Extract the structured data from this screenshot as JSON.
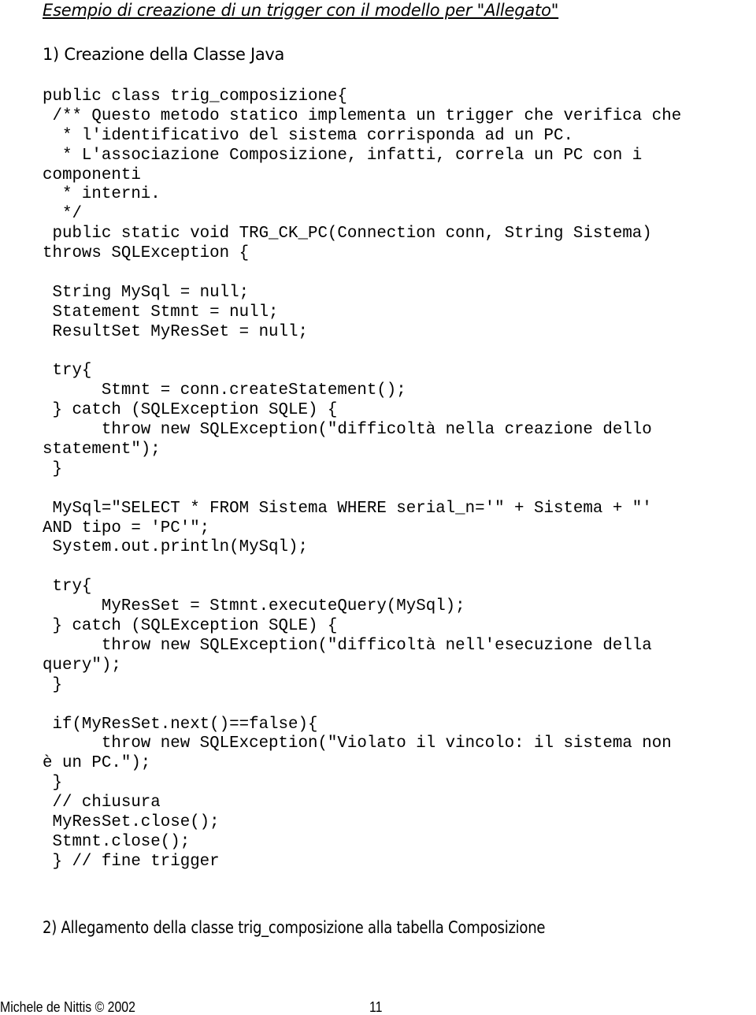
{
  "document": {
    "title": "Esempio di creazione di un trigger con il modello per \"Allegato\"",
    "section1_heading": "1) Creazione della Classe Java",
    "code_lines": [
      "public class trig_composizione{",
      " /** Questo metodo statico implementa un trigger che verifica che",
      "  * l'identificativo del sistema corrisponda ad un PC.",
      "  * L'associazione Composizione, infatti, correla un PC con i",
      "componenti",
      "  * interni.",
      "  */",
      " public static void TRG_CK_PC(Connection conn, String Sistema)",
      "throws SQLException {",
      "",
      " String MySql = null;",
      " Statement Stmnt = null;",
      " ResultSet MyResSet = null;",
      "",
      " try{",
      "      Stmnt = conn.createStatement();",
      " } catch (SQLException SQLE) {",
      "      throw new SQLException(\"difficoltà nella creazione dello",
      "statement\");",
      " }",
      "",
      " MySql=\"SELECT * FROM Sistema WHERE serial_n='\" + Sistema + \"'",
      "AND tipo = 'PC'\";",
      " System.out.println(MySql);",
      "",
      " try{",
      "      MyResSet = Stmnt.executeQuery(MySql);",
      " } catch (SQLException SQLE) {",
      "      throw new SQLException(\"difficoltà nell'esecuzione della",
      "query\");",
      " }",
      "",
      " if(MyResSet.next()==false){",
      "      throw new SQLException(\"Violato il vincolo: il sistema non",
      "è un PC.\");",
      " }",
      " // chiusura",
      " MyResSet.close();",
      " Stmnt.close();",
      " } // fine trigger"
    ],
    "section2_heading": "2) Allegamento della classe trig_composizione alla tabella Composizione"
  },
  "footer": {
    "author": "Michele de Nittis © 2002",
    "page_number": "11"
  }
}
